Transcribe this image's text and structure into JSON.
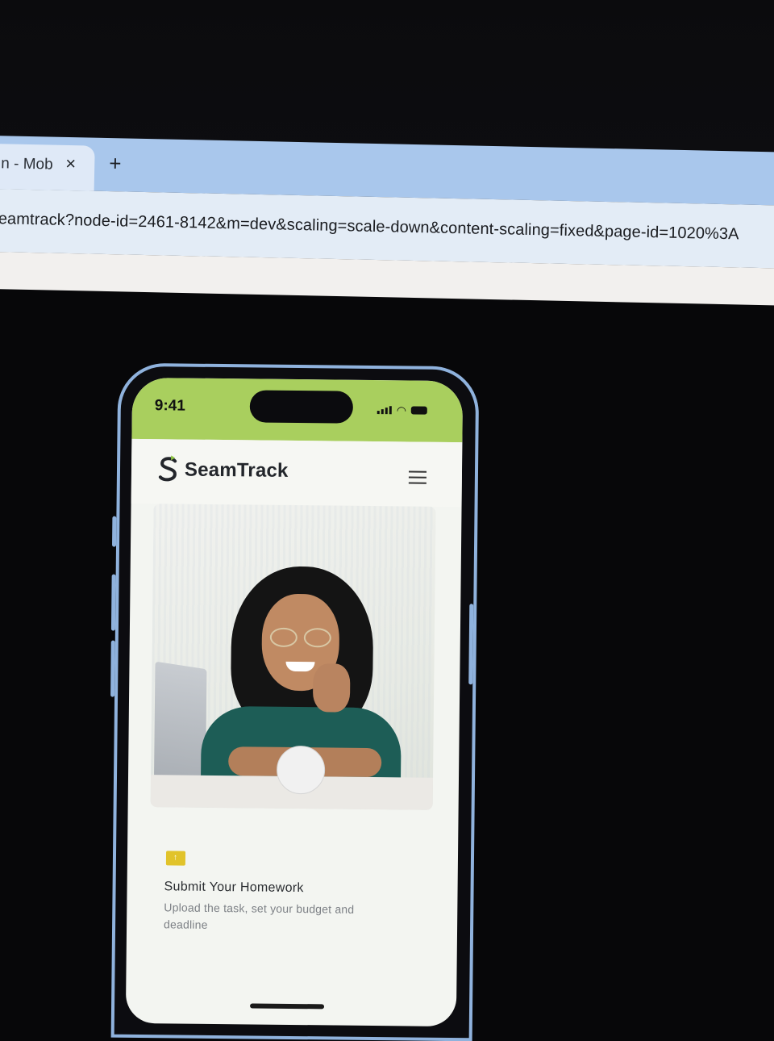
{
  "browser": {
    "tab_title": "n - Mob",
    "tab_close": "×",
    "new_tab": "+",
    "url": "eamtrack?node-id=2461-8142&m=dev&scaling=scale-down&content-scaling=fixed&page-id=1020%3A"
  },
  "phone": {
    "status": {
      "time": "9:41"
    },
    "app": {
      "logo_text": "SeamTrack",
      "brand_color": "#a9cf5e"
    },
    "feature": {
      "title": "Submit Your Homework",
      "description": "Upload the task, set your budget and deadline",
      "icon": "folder-upload-icon",
      "icon_color": "#e1c32a"
    }
  }
}
